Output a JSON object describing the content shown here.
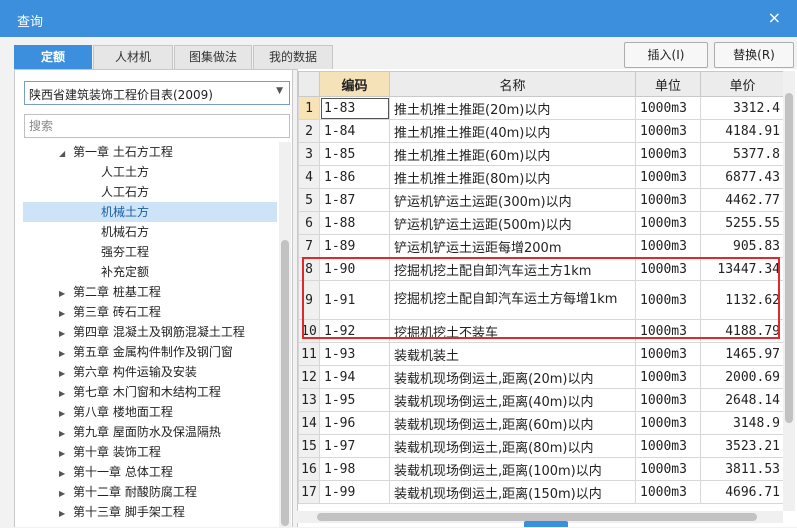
{
  "window": {
    "title": "查询",
    "close_glyph": "×"
  },
  "tabs": [
    {
      "label": "定额",
      "active": true
    },
    {
      "label": "人材机",
      "active": false
    },
    {
      "label": "图集做法",
      "active": false
    },
    {
      "label": "我的数据",
      "active": false
    }
  ],
  "buttons": {
    "insert": "插入(I)",
    "replace": "替换(R)"
  },
  "library_select": {
    "value": "陕西省建筑装饰工程价目表(2009)"
  },
  "search": {
    "placeholder": "搜索"
  },
  "tree": [
    {
      "label": "第一章 土石方工程",
      "level": 0,
      "toggle": "◢"
    },
    {
      "label": "人工土方",
      "level": 1
    },
    {
      "label": "人工石方",
      "level": 1
    },
    {
      "label": "机械土方",
      "level": 1,
      "selected": true
    },
    {
      "label": "机械石方",
      "level": 1
    },
    {
      "label": "强夯工程",
      "level": 1
    },
    {
      "label": "补充定额",
      "level": 1
    },
    {
      "label": "第二章 桩基工程",
      "level": 0,
      "toggle": "▶"
    },
    {
      "label": "第三章 砖石工程",
      "level": 0,
      "toggle": "▶"
    },
    {
      "label": "第四章 混凝土及钢筋混凝土工程",
      "level": 0,
      "toggle": "▶"
    },
    {
      "label": "第五章 金属构件制作及钢门窗",
      "level": 0,
      "toggle": "▶"
    },
    {
      "label": "第六章 构件运输及安装",
      "level": 0,
      "toggle": "▶"
    },
    {
      "label": "第七章 木门窗和木结构工程",
      "level": 0,
      "toggle": "▶"
    },
    {
      "label": "第八章 楼地面工程",
      "level": 0,
      "toggle": "▶"
    },
    {
      "label": "第九章 屋面防水及保温隔热",
      "level": 0,
      "toggle": "▶"
    },
    {
      "label": "第十章 装饰工程",
      "level": 0,
      "toggle": "▶"
    },
    {
      "label": "第十一章 总体工程",
      "level": 0,
      "toggle": "▶"
    },
    {
      "label": "第十二章 耐酸防腐工程",
      "level": 0,
      "toggle": "▶"
    },
    {
      "label": "第十三章 脚手架工程",
      "level": 0,
      "toggle": "▶"
    }
  ],
  "table": {
    "headers": {
      "code": "编码",
      "name": "名称",
      "unit": "单位",
      "price": "单价"
    },
    "rows": [
      {
        "idx": "1",
        "code": "1-83",
        "name": "推土机推土推距(20m)以内",
        "unit": "1000m3",
        "price": "3312.4"
      },
      {
        "idx": "2",
        "code": "1-84",
        "name": "推土机推土推距(40m)以内",
        "unit": "1000m3",
        "price": "4184.91"
      },
      {
        "idx": "3",
        "code": "1-85",
        "name": "推土机推土推距(60m)以内",
        "unit": "1000m3",
        "price": "5377.8"
      },
      {
        "idx": "4",
        "code": "1-86",
        "name": "推土机推土推距(80m)以内",
        "unit": "1000m3",
        "price": "6877.43"
      },
      {
        "idx": "5",
        "code": "1-87",
        "name": "铲运机铲运土运距(300m)以内",
        "unit": "1000m3",
        "price": "4462.77"
      },
      {
        "idx": "6",
        "code": "1-88",
        "name": "铲运机铲运土运距(500m)以内",
        "unit": "1000m3",
        "price": "5255.55"
      },
      {
        "idx": "7",
        "code": "1-89",
        "name": "铲运机铲运土运距每增200m",
        "unit": "1000m3",
        "price": "905.83"
      },
      {
        "idx": "8",
        "code": "1-90",
        "name": "挖掘机挖土配自卸汽车运土方1km",
        "unit": "1000m3",
        "price": "13447.34"
      },
      {
        "idx": "9",
        "code": "1-91",
        "name": "挖掘机挖土配自卸汽车运土方每增1km",
        "unit": "1000m3",
        "price": "1132.62"
      },
      {
        "idx": "10",
        "code": "1-92",
        "name": "挖掘机挖土不装车",
        "unit": "1000m3",
        "price": "4188.79"
      },
      {
        "idx": "11",
        "code": "1-93",
        "name": "装载机装土",
        "unit": "1000m3",
        "price": "1465.97"
      },
      {
        "idx": "12",
        "code": "1-94",
        "name": "装载机现场倒运土,距离(20m)以内",
        "unit": "1000m3",
        "price": "2000.69"
      },
      {
        "idx": "13",
        "code": "1-95",
        "name": "装载机现场倒运土,距离(40m)以内",
        "unit": "1000m3",
        "price": "2648.14"
      },
      {
        "idx": "14",
        "code": "1-96",
        "name": "装载机现场倒运土,距离(60m)以内",
        "unit": "1000m3",
        "price": "3148.9"
      },
      {
        "idx": "15",
        "code": "1-97",
        "name": "装载机现场倒运土,距离(80m)以内",
        "unit": "1000m3",
        "price": "3523.21"
      },
      {
        "idx": "16",
        "code": "1-98",
        "name": "装载机现场倒运土,距离(100m)以内",
        "unit": "1000m3",
        "price": "3811.53"
      },
      {
        "idx": "17",
        "code": "1-99",
        "name": "装载机现场倒运土,距离(150m)以内",
        "unit": "1000m3",
        "price": "4696.71"
      }
    ]
  },
  "colors": {
    "accent": "#3b8fdc",
    "highlight_box": "#e12929",
    "selected_header": "#f6e2b8"
  }
}
